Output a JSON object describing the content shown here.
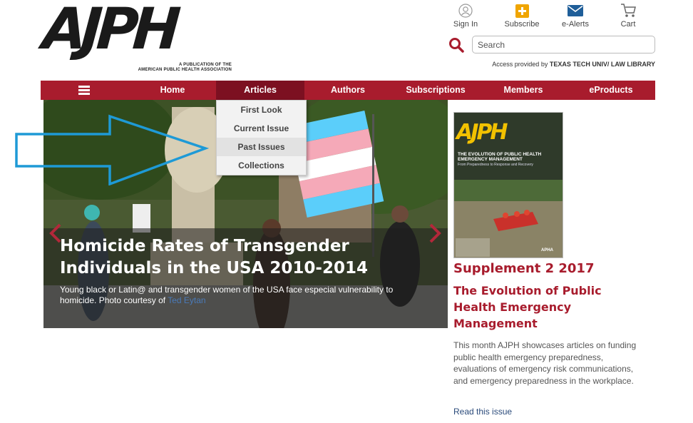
{
  "logo": {
    "text": "AJPH",
    "subtitle_line1": "A PUBLICATION OF THE",
    "subtitle_line2": "AMERICAN PUBLIC HEALTH ASSOCIATION"
  },
  "utility": {
    "sign_in": "Sign In",
    "subscribe": "Subscribe",
    "e_alerts": "e-Alerts",
    "cart": "Cart"
  },
  "search": {
    "placeholder": "Search"
  },
  "access": {
    "prefix": "Access provided by ",
    "institution": "TEXAS TECH UNIV/ LAW LIBRARY"
  },
  "nav": {
    "home": "Home",
    "articles": "Articles",
    "authors": "Authors",
    "subscriptions": "Subscriptions",
    "members": "Members",
    "eproducts": "eProducts"
  },
  "dropdown": {
    "items": [
      "First Look",
      "Current Issue",
      "Past Issues",
      "Collections"
    ],
    "hovered": "Past Issues"
  },
  "hero": {
    "title": "Homicide Rates of Transgender Individuals in the USA 2010-2014",
    "desc": "Young black or Latin@ and transgender women of the USA face especial vulnerability to homicide. Photo courtesy of ",
    "credit": "Ted Eytan"
  },
  "cover": {
    "logo": "AJPH",
    "title": "THE EVOLUTION OF PUBLIC HEALTH EMERGENCY MANAGEMENT",
    "subtitle": "From Preparedness to Response and Recovery",
    "badge": "APHA"
  },
  "sidebar": {
    "supplement": "Supplement 2 2017",
    "title": "The Evolution of Public Health Emergency Management",
    "desc": "This month AJPH showcases articles on funding public health emergency preparedness, evaluations of emergency risk communications, and emergency preparedness in the workplace.",
    "read_link": "Read this issue"
  },
  "colors": {
    "brand": "#a81c2d",
    "nav_active": "#7c1021",
    "annotation": "#1e9ad6"
  }
}
